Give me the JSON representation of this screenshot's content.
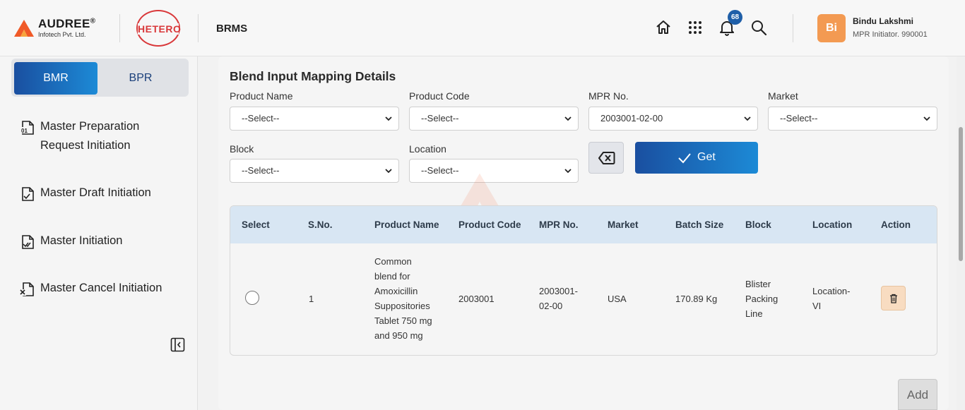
{
  "header": {
    "brand_name": "AUDREE",
    "brand_registered": "®",
    "brand_sub": "Infotech Pvt. Ltd.",
    "partner_logo": "HETERO",
    "app_name": "BRMS",
    "notification_count": "68",
    "user": {
      "initials": "Bi",
      "name": "Bindu Lakshmi",
      "role": "MPR Initiator. 990001"
    },
    "icons": [
      "home-icon",
      "apps-grid-icon",
      "bell-icon",
      "search-icon"
    ]
  },
  "sidebar": {
    "toggle": {
      "bmr": "BMR",
      "bpr": "BPR",
      "active": "BMR"
    },
    "items": [
      {
        "line1": "Master Preparation",
        "line2": "Request Initiation",
        "icon": "document-01-icon"
      },
      {
        "line1": "Master Draft Initiation",
        "line2": "",
        "icon": "document-check-icon"
      },
      {
        "line1": "Master Initiation",
        "line2": "",
        "icon": "document-double-check-icon"
      },
      {
        "line1": "Master Cancel Initiation",
        "line2": "",
        "icon": "document-cancel-icon"
      }
    ]
  },
  "form": {
    "title": "Blend Input Mapping Details",
    "product_name": {
      "label": "Product Name",
      "value": "--Select--"
    },
    "product_code": {
      "label": "Product Code",
      "value": "--Select--"
    },
    "mpr_no": {
      "label": "MPR No.",
      "value": "2003001-02-00"
    },
    "market": {
      "label": "Market",
      "value": "--Select--"
    },
    "block": {
      "label": "Block",
      "value": "--Select--"
    },
    "location": {
      "label": "Location",
      "value": "--Select--"
    },
    "get_label": "Get"
  },
  "table": {
    "headers": [
      "Select",
      "S.No.",
      "Product Name",
      "Product Code",
      "MPR No.",
      "Market",
      "Batch Size",
      "Block",
      "Location",
      "Action"
    ],
    "rows": [
      {
        "sno": "1",
        "product_name": [
          "Common",
          "blend for",
          "Amoxicillin",
          "Suppositories",
          "Tablet 750 mg",
          "and 950 mg"
        ],
        "product_code": "2003001",
        "mpr_no": [
          "2003001-",
          "02-00"
        ],
        "market": "USA",
        "batch_size": "170.89 Kg",
        "block": [
          "Blister",
          "Packing",
          "Line"
        ],
        "location": [
          "Location-",
          "VI"
        ]
      }
    ]
  },
  "add_label": "Add"
}
